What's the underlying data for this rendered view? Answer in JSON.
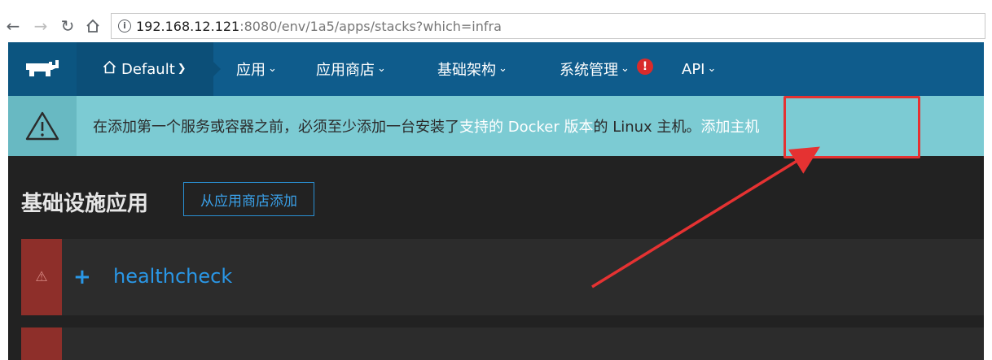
{
  "browser": {
    "url_host": "192.168.12.121",
    "url_path": ":8080/env/1a5/apps/stacks?which=infra",
    "back_icon": "arrow-left-icon",
    "forward_icon": "arrow-right-icon",
    "reload_icon": "reload-icon",
    "home_icon": "home-icon",
    "info_icon": "info-icon"
  },
  "nav": {
    "environment": "Default",
    "items": [
      {
        "label": "应用"
      },
      {
        "label": "应用商店"
      },
      {
        "label": "基础架构"
      },
      {
        "label": "系统管理"
      },
      {
        "label": "API"
      }
    ],
    "alert_badge": "!"
  },
  "banner": {
    "text_before": "在添加第一个服务或容器之前，必须至少添加一台安装了",
    "link_docker": "支持的 Docker 版本",
    "text_middle": " 的 Linux 主机。",
    "link_add_host": "添加主机"
  },
  "page": {
    "title": "基础设施应用",
    "add_from_catalog": "从应用商店添加"
  },
  "stacks": [
    {
      "name": "healthcheck",
      "state": "warning"
    },
    {
      "name": "",
      "state": "warning"
    }
  ],
  "colors": {
    "nav_bg": "#0f5c8c",
    "banner_bg": "#7ccbd3",
    "link_blue": "#2a97e6",
    "error_red": "#8e2f2a",
    "annotation_red": "#e53232"
  }
}
